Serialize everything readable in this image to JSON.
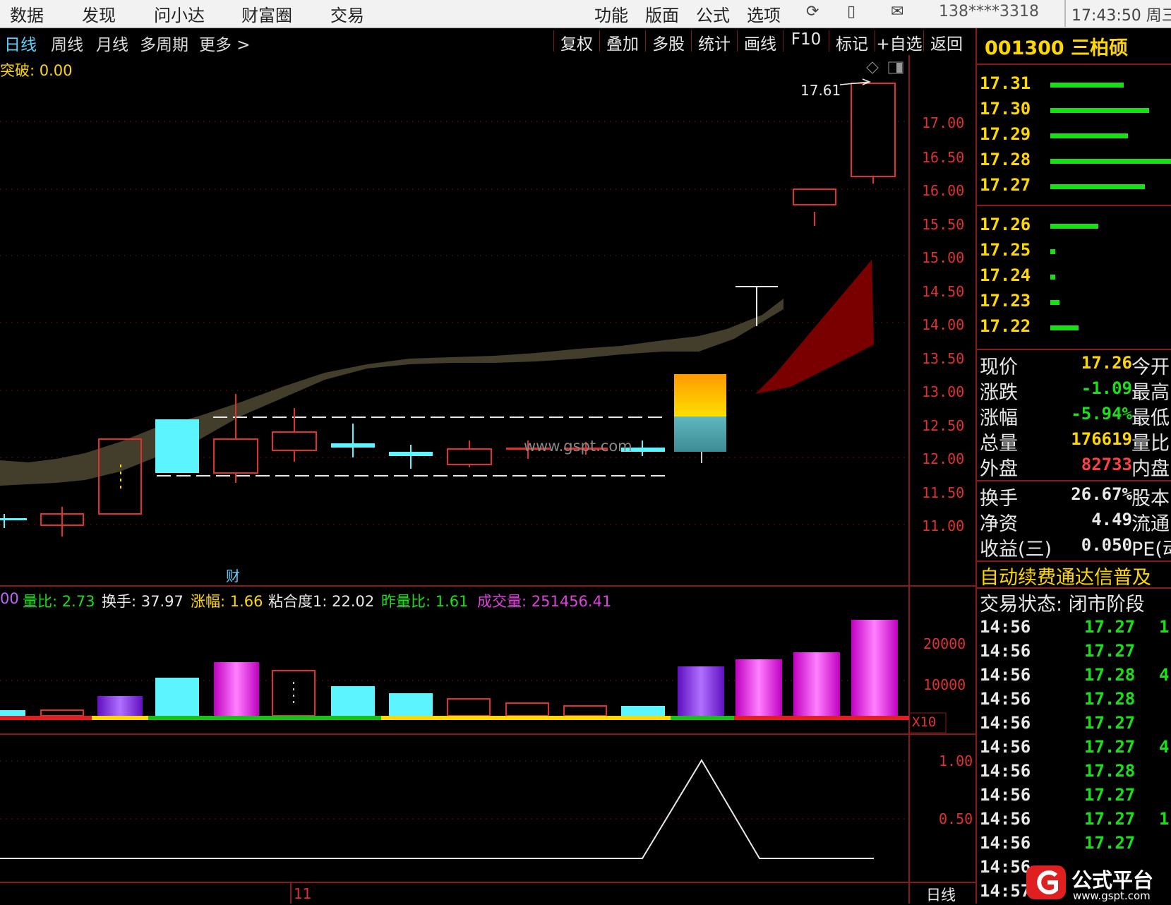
{
  "top_menu": {
    "left_items": [
      "数据",
      "发现",
      "问小达",
      "财富圈",
      "交易"
    ],
    "right_items": [
      "功能",
      "版面",
      "公式",
      "选项"
    ],
    "phone": "138****3318",
    "time": "17:43:50 周三"
  },
  "periods": {
    "items": [
      "日线",
      "周线",
      "月线",
      "多周期",
      "更多 >"
    ],
    "active": "日线"
  },
  "chart_toolbar": [
    "复权",
    "叠加",
    "多股",
    "统计",
    "画线",
    "F10",
    "标记",
    "+自选",
    "返回"
  ],
  "main_chart": {
    "indicator_label": "突破: 0.00",
    "max_label": "17.61",
    "y_ticks": [
      "17.00",
      "16.50",
      "16.00",
      "15.50",
      "15.00",
      "14.50",
      "14.00",
      "13.50",
      "13.00",
      "12.50",
      "12.00",
      "11.50",
      "11.00"
    ],
    "watermark": "www.gspt.com",
    "cai_marker": "财",
    "colors": {
      "up": "#e03030",
      "down": "#5cf4ff",
      "band": "#4a4530",
      "red_fill": "#7a0000",
      "gold": "#ffcc00",
      "teal": "#4aa0a8"
    }
  },
  "volume_panel": {
    "indicators": [
      {
        "label": "00",
        "color": "#c060ff"
      },
      {
        "label": "量比: 2.73",
        "color": "#19e019"
      },
      {
        "label": "换手: 37.97",
        "color": "#e8e8e8"
      },
      {
        "label": "涨幅: 1.66",
        "color": "#ffd700"
      },
      {
        "label": "粘合度1: 22.02",
        "color": "#e8e8e8"
      },
      {
        "label": "昨量比: 1.61",
        "color": "#19e019"
      },
      {
        "label": "成交量: 251456.41",
        "color": "#e040e0"
      }
    ],
    "y_ticks": [
      "20000",
      "10000"
    ],
    "unit": "X10"
  },
  "lower_panel": {
    "y_ticks": [
      "1.00",
      "0.50"
    ],
    "date_label": "11",
    "period_label": "日线"
  },
  "stock": {
    "code": "001300",
    "name": "三柏硕"
  },
  "order_book": [
    {
      "price": "17.31"
    },
    {
      "price": "17.30"
    },
    {
      "price": "17.29"
    },
    {
      "price": "17.28"
    },
    {
      "price": "17.27"
    },
    {
      "price": "17.26"
    },
    {
      "price": "17.25"
    },
    {
      "price": "17.24"
    },
    {
      "price": "17.23"
    },
    {
      "price": "17.22"
    }
  ],
  "quote": [
    {
      "label": "现价",
      "value": "17.26",
      "label2": "今开",
      "color": "#ffd700"
    },
    {
      "label": "涨跌",
      "value": "-1.09",
      "label2": "最高",
      "color": "#19e019"
    },
    {
      "label": "涨幅",
      "value": "-5.94%",
      "label2": "最低",
      "color": "#19e019"
    },
    {
      "label": "总量",
      "value": "176619",
      "label2": "量比",
      "color": "#ffd700"
    },
    {
      "label": "外盘",
      "value": "82733",
      "label2": "内盘",
      "color": "#ff4040"
    },
    {
      "label": "换手",
      "value": "26.67%",
      "label2": "股本",
      "color": "#e8e8e8"
    },
    {
      "label": "净资",
      "value": "4.49",
      "label2": "流通",
      "color": "#e8e8e8"
    },
    {
      "label": "收益(三)",
      "value": "0.050",
      "label2": "PE(动",
      "color": "#e8e8e8"
    }
  ],
  "banner": "自动续费通达信普及",
  "trade_status": "交易状态: 闭市阶段",
  "ticks": [
    {
      "time": "14:56",
      "price": "17.27",
      "vol": "1"
    },
    {
      "time": "14:56",
      "price": "17.27",
      "vol": ""
    },
    {
      "time": "14:56",
      "price": "17.28",
      "vol": "4"
    },
    {
      "time": "14:56",
      "price": "17.28",
      "vol": ""
    },
    {
      "time": "14:56",
      "price": "17.27",
      "vol": ""
    },
    {
      "time": "14:56",
      "price": "17.27",
      "vol": "4"
    },
    {
      "time": "14:56",
      "price": "17.28",
      "vol": ""
    },
    {
      "time": "14:56",
      "price": "17.27",
      "vol": ""
    },
    {
      "time": "14:56",
      "price": "17.27",
      "vol": "1"
    },
    {
      "time": "14:56",
      "price": "17.27",
      "vol": ""
    },
    {
      "time": "14:56",
      "price": "",
      "vol": ""
    },
    {
      "time": "14:57",
      "price": "",
      "vol": ""
    }
  ],
  "logo": {
    "title": "公式平台",
    "url": "www.gspt.com"
  }
}
